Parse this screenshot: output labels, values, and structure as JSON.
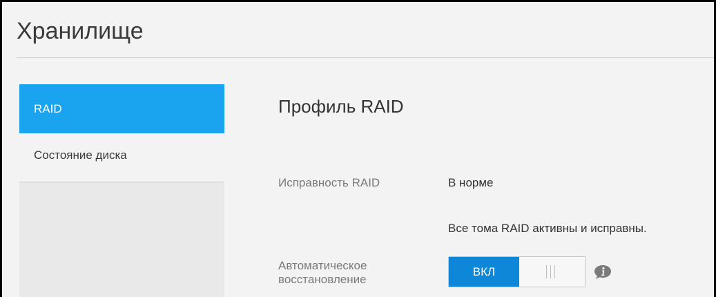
{
  "page": {
    "title": "Хранилище"
  },
  "sidebar": {
    "items": [
      {
        "label": "RAID",
        "active": true
      },
      {
        "label": "Состояние диска",
        "active": false
      }
    ]
  },
  "main": {
    "section_title": "Профиль RAID",
    "raid_health": {
      "label": "Исправность RAID",
      "value": "В норме",
      "detail": "Все тома RAID активны и исправны."
    },
    "auto_rebuild": {
      "label_line1": "Автоматическое",
      "label_line2": "восстановление",
      "toggle_on_label": "ВКЛ",
      "state": "on",
      "info_icon": "info-icon"
    }
  },
  "colors": {
    "accent": "#1aa3ee",
    "toggle_on": "#0f87d8",
    "background": "#f3f3f3"
  }
}
